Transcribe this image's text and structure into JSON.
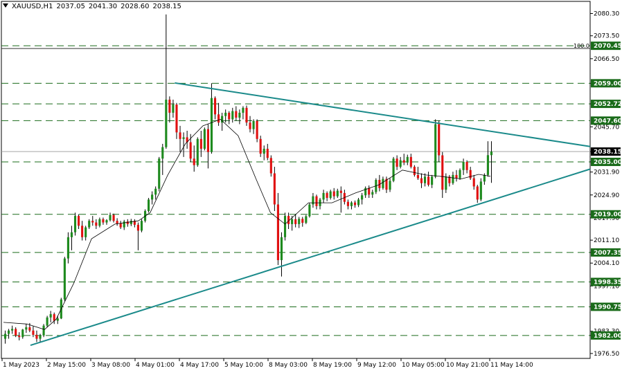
{
  "header": {
    "symbol": "XAUUSD,H1",
    "open": "2037.05",
    "high": "2041.30",
    "low": "2028.60",
    "close": "2038.15"
  },
  "colors": {
    "background": "#ffffff",
    "bull": "#1e8a1e",
    "bear": "#e01010",
    "wick": "#000000",
    "trendline": "#1a8a8a",
    "level_line": "#1a6b1a",
    "level_label_bg": "#1a6b1a",
    "price_label_bg": "#000000",
    "ma_line": "#000000"
  },
  "chart_data": {
    "type": "candlestick",
    "symbol": "XAUUSD",
    "timeframe": "H1",
    "ylim": [
      1975.0,
      2084.0
    ],
    "y_ticks": [
      "2080.30",
      "2073.50",
      "2066.50",
      "2059.00",
      "2052.72",
      "2045.70",
      "2038.15",
      "2035.00",
      "2031.90",
      "2024.90",
      "2019.00",
      "2017.90",
      "2011.10",
      "2007.35",
      "2004.10",
      "1998.35",
      "1997.10",
      "1990.75",
      "1983.30",
      "1982.00",
      "1976.50"
    ],
    "x_ticks": [
      "1 May 2023",
      "2 May 15:00",
      "3 May 08:00",
      "4 May 01:00",
      "4 May 17:00",
      "5 May 10:00",
      "8 May 03:00",
      "8 May 19:00",
      "9 May 12:00",
      "10 May 05:00",
      "10 May 21:00",
      "11 May 14:00"
    ],
    "current_price": "2038.15",
    "fib_label": "100.0",
    "levels": [
      {
        "value": 2070.45,
        "label": "2070.45"
      },
      {
        "value": 2059.0,
        "label": "2059.00"
      },
      {
        "value": 2052.72,
        "label": "2052.72"
      },
      {
        "value": 2047.6,
        "label": "2047.60"
      },
      {
        "value": 2035.0,
        "label": "2035.00"
      },
      {
        "value": 2019.0,
        "label": "2019.00"
      },
      {
        "value": 2007.35,
        "label": "2007.35"
      },
      {
        "value": 1998.35,
        "label": "1998.35"
      },
      {
        "value": 1990.75,
        "label": "1990.75"
      },
      {
        "value": 1982.0,
        "label": "1982.00"
      }
    ],
    "trendlines": [
      {
        "name": "upper",
        "from": [
          0.292,
          2059.1
        ],
        "to": [
          1.0,
          2039.7
        ]
      },
      {
        "name": "lower",
        "from": [
          0.046,
          1979.0
        ],
        "to": [
          1.0,
          2032.8
        ]
      }
    ],
    "candles": [
      [
        1981,
        1983.5,
        1979.5,
        1982.5
      ],
      [
        1982.5,
        1984,
        1981,
        1983.5
      ],
      [
        1983.5,
        1985,
        1982.5,
        1984
      ],
      [
        1984,
        1984.5,
        1981.5,
        1982
      ],
      [
        1982,
        1983,
        1980.5,
        1981.5
      ],
      [
        1981.5,
        1984,
        1981,
        1983.8
      ],
      [
        1983.8,
        1985.5,
        1982.8,
        1984.5
      ],
      [
        1984.5,
        1985.8,
        1983,
        1983.5
      ],
      [
        1983.5,
        1984.8,
        1981.5,
        1982.2
      ],
      [
        1982.2,
        1983.5,
        1980,
        1981
      ],
      [
        1981,
        1982.5,
        1979.8,
        1982
      ],
      [
        1982,
        1985.5,
        1981.5,
        1985
      ],
      [
        1985,
        1988,
        1984.5,
        1987.5
      ],
      [
        1987.5,
        1989.5,
        1986,
        1988.5
      ],
      [
        1988.5,
        1989,
        1985.5,
        1986.5
      ],
      [
        1986.5,
        1988,
        1985.5,
        1987.2
      ],
      [
        1987.2,
        1993.5,
        1987,
        1993
      ],
      [
        1993,
        2006,
        1992.5,
        2005.5
      ],
      [
        2005.5,
        2013.5,
        2004,
        2012
      ],
      [
        2012,
        2015.5,
        2008,
        2013.5
      ],
      [
        2013.5,
        2019.5,
        2012.5,
        2018.5
      ],
      [
        2018.5,
        2019,
        2014.5,
        2015.5
      ],
      [
        2015.5,
        2017,
        2011,
        2012
      ],
      [
        2012,
        2015.5,
        2011,
        2015
      ],
      [
        2015,
        2017.5,
        2014.5,
        2017
      ],
      [
        2017,
        2018.5,
        2015.5,
        2016.5
      ],
      [
        2016.5,
        2017.5,
        2014.5,
        2015.5
      ],
      [
        2015.5,
        2018,
        2015,
        2017.5
      ],
      [
        2017.5,
        2018,
        2015.8,
        2016.5
      ],
      [
        2016.5,
        2017.5,
        2015.8,
        2017.2
      ],
      [
        2017.2,
        2019.5,
        2016.8,
        2018.8
      ],
      [
        2018.8,
        2019.2,
        2016.5,
        2017
      ],
      [
        2017,
        2017.8,
        2015.5,
        2016.2
      ],
      [
        2016.2,
        2017,
        2014.5,
        2015
      ],
      [
        2015,
        2017.3,
        2014.2,
        2016.8
      ],
      [
        2016.8,
        2017.5,
        2015.2,
        2016
      ],
      [
        2016,
        2017.6,
        2015.4,
        2017
      ],
      [
        2017,
        2017.5,
        2015,
        2015.8
      ],
      [
        2015.8,
        2016.5,
        2008,
        2014
      ],
      [
        2014,
        2017.5,
        2013.5,
        2017
      ],
      [
        2017,
        2020.5,
        2016.5,
        2020
      ],
      [
        2020,
        2024,
        2019.5,
        2023.5
      ],
      [
        2023.5,
        2026,
        2022,
        2025
      ],
      [
        2025,
        2027.5,
        2023.5,
        2026.8
      ],
      [
        2026.8,
        2036.5,
        2026,
        2036
      ],
      [
        2036,
        2040.5,
        2031,
        2039.5
      ],
      [
        2039.5,
        2080,
        2039,
        2054
      ],
      [
        2054,
        2055,
        2047,
        2050
      ],
      [
        2050,
        2054,
        2048.5,
        2052.5
      ],
      [
        2052.5,
        2053,
        2042,
        2044
      ],
      [
        2044,
        2046,
        2038,
        2042
      ],
      [
        2042,
        2044,
        2036.5,
        2042.5
      ],
      [
        2042.5,
        2044.5,
        2039,
        2041
      ],
      [
        2041,
        2043.5,
        2035,
        2036
      ],
      [
        2036,
        2040,
        2032,
        2034
      ],
      [
        2034,
        2042.5,
        2033.5,
        2042
      ],
      [
        2042,
        2044.5,
        2036.5,
        2039
      ],
      [
        2039,
        2045.5,
        2038.5,
        2045
      ],
      [
        2045,
        2046.5,
        2033,
        2038
      ],
      [
        2038,
        2059,
        2037.5,
        2054.5
      ],
      [
        2054.5,
        2055,
        2048,
        2049.5
      ],
      [
        2049.5,
        2053,
        2046,
        2047
      ],
      [
        2047,
        2050,
        2044.5,
        2049
      ],
      [
        2049,
        2051,
        2047,
        2050
      ],
      [
        2050,
        2050.5,
        2046.5,
        2048
      ],
      [
        2048,
        2051.5,
        2047,
        2050.5
      ],
      [
        2050.5,
        2052,
        2047.5,
        2048.5
      ],
      [
        2048.5,
        2051,
        2046.5,
        2050
      ],
      [
        2050,
        2052,
        2048,
        2051.5
      ],
      [
        2051.5,
        2052.2,
        2046,
        2047
      ],
      [
        2047,
        2049,
        2044,
        2045
      ],
      [
        2045,
        2048,
        2043.5,
        2047.5
      ],
      [
        2047.5,
        2048,
        2041,
        2042
      ],
      [
        2042,
        2043,
        2036.5,
        2037.5
      ],
      [
        2037.5,
        2040,
        2035.5,
        2039
      ],
      [
        2039,
        2040.5,
        2035.5,
        2036.2
      ],
      [
        2036.2,
        2037,
        2030.5,
        2031.5
      ],
      [
        2031.5,
        2033.5,
        2020,
        2022
      ],
      [
        2022,
        2025.5,
        2003.5,
        2005
      ],
      [
        2005,
        2013.5,
        2000,
        2012
      ],
      [
        2012,
        2019.5,
        2011,
        2018.5
      ],
      [
        2018.5,
        2019.5,
        2014.5,
        2016
      ],
      [
        2016,
        2018.5,
        2014,
        2017.5
      ],
      [
        2017.5,
        2019,
        2015,
        2016
      ],
      [
        2016,
        2018.2,
        2014.8,
        2017.6
      ],
      [
        2017.6,
        2018.2,
        2015.2,
        2016.4
      ],
      [
        2016.4,
        2018.8,
        2016,
        2018.4
      ],
      [
        2018.4,
        2022.5,
        2018,
        2022
      ],
      [
        2022,
        2025.5,
        2021,
        2024.5
      ],
      [
        2024.5,
        2025,
        2020.5,
        2021.5
      ],
      [
        2021.5,
        2024,
        2020.5,
        2023.5
      ],
      [
        2023.5,
        2026.5,
        2022.5,
        2025.5
      ],
      [
        2025.5,
        2026,
        2023,
        2024
      ],
      [
        2024,
        2026.5,
        2023.5,
        2026
      ],
      [
        2026,
        2027,
        2023.5,
        2024.5
      ],
      [
        2024.5,
        2026.8,
        2024,
        2026.2
      ],
      [
        2026.2,
        2027.5,
        2019.5,
        2025.5
      ],
      [
        2025.5,
        2026.5,
        2022,
        2022.8
      ],
      [
        2022.8,
        2023.5,
        2020.5,
        2021.5
      ],
      [
        2021.5,
        2023,
        2020.5,
        2022.6
      ],
      [
        2022.6,
        2023.2,
        2021,
        2021.8
      ],
      [
        2021.8,
        2024,
        2021.2,
        2023.5
      ],
      [
        2023.5,
        2025.5,
        2022,
        2024.8
      ],
      [
        2024.8,
        2027.5,
        2024,
        2027
      ],
      [
        2027,
        2027.8,
        2024,
        2025
      ],
      [
        2025,
        2026.5,
        2024,
        2025.8
      ],
      [
        2025.8,
        2030,
        2025.2,
        2029.5
      ],
      [
        2029.5,
        2031,
        2026,
        2027
      ],
      [
        2027,
        2030.5,
        2026.5,
        2029.8
      ],
      [
        2029.8,
        2030.5,
        2025.5,
        2026.5
      ],
      [
        2026.5,
        2030,
        2025.8,
        2029.2
      ],
      [
        2029.2,
        2036.5,
        2028.8,
        2036
      ],
      [
        2036,
        2037,
        2032.5,
        2033.5
      ],
      [
        2033.5,
        2036.5,
        2033,
        2035.5
      ],
      [
        2035.5,
        2037.5,
        2034,
        2034.8
      ],
      [
        2034.8,
        2037.2,
        2034,
        2036.5
      ],
      [
        2036.5,
        2037.5,
        2033,
        2033.5
      ],
      [
        2033.5,
        2034,
        2030.5,
        2031
      ],
      [
        2031,
        2033.5,
        2029.5,
        2030
      ],
      [
        2030,
        2031.5,
        2027,
        2028.5
      ],
      [
        2028.5,
        2031.5,
        2027.5,
        2030.5
      ],
      [
        2030.5,
        2032,
        2027.5,
        2028
      ],
      [
        2028,
        2031,
        2027,
        2030.5
      ],
      [
        2030.5,
        2048,
        2030,
        2046.5
      ],
      [
        2046.5,
        2047.6,
        2035,
        2037
      ],
      [
        2037,
        2038,
        2024,
        2026.5
      ],
      [
        2026.5,
        2031.5,
        2025.5,
        2030.5
      ],
      [
        2030.5,
        2031,
        2027.5,
        2028.5
      ],
      [
        2028.5,
        2032,
        2028,
        2031
      ],
      [
        2031,
        2032.5,
        2029,
        2030
      ],
      [
        2030,
        2033,
        2029.5,
        2032.5
      ],
      [
        2032.5,
        2036,
        2031,
        2035
      ],
      [
        2035,
        2035.5,
        2031.5,
        2032.5
      ],
      [
        2032.5,
        2033.5,
        2029.5,
        2030
      ],
      [
        2030,
        2031,
        2026.5,
        2027.5
      ],
      [
        2027.5,
        2028,
        2022.5,
        2023.5
      ],
      [
        2023.5,
        2030,
        2023,
        2029
      ],
      [
        2029,
        2031.5,
        2028,
        2031
      ],
      [
        2031,
        2041.3,
        2030.5,
        2037.05
      ],
      [
        2037.05,
        2041.3,
        2028.6,
        2038.15
      ]
    ],
    "ma": [
      [
        0.0,
        1986.0
      ],
      [
        0.04,
        1985.5
      ],
      [
        0.07,
        1983.8
      ],
      [
        0.09,
        1987.0
      ],
      [
        0.12,
        1998.0
      ],
      [
        0.15,
        2011.5
      ],
      [
        0.19,
        2016.0
      ],
      [
        0.23,
        2017.0
      ],
      [
        0.25,
        2019.5
      ],
      [
        0.28,
        2031.0
      ],
      [
        0.31,
        2040.5
      ],
      [
        0.34,
        2046.0
      ],
      [
        0.37,
        2048.0
      ],
      [
        0.4,
        2043.0
      ],
      [
        0.43,
        2030.0
      ],
      [
        0.455,
        2019.5
      ],
      [
        0.48,
        2016.0
      ],
      [
        0.52,
        2022.5
      ],
      [
        0.56,
        2022.5
      ],
      [
        0.6,
        2025.5
      ],
      [
        0.64,
        2028.0
      ],
      [
        0.68,
        2032.5
      ],
      [
        0.72,
        2031.0
      ],
      [
        0.75,
        2030.5
      ],
      [
        0.78,
        2029.8
      ],
      [
        0.81,
        2031.2
      ],
      [
        0.83,
        2030.6
      ]
    ]
  }
}
